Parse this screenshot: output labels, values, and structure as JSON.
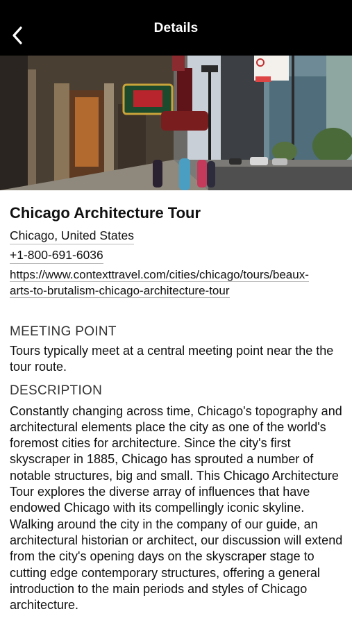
{
  "navbar": {
    "title": "Details",
    "back_icon": "chevron-left-icon",
    "background": "#000000"
  },
  "hero_image": {
    "description_icon": "street-photo"
  },
  "tour": {
    "title": "Chicago Architecture Tour",
    "location": "Chicago, United States",
    "phone": "+1-800-691-6036",
    "url": "https://www.contexttravel.com/cities/chicago/tours/beaux-arts-to-brutalism-chicago-architecture-tour"
  },
  "meeting_point": {
    "heading": "MEETING POINT",
    "text": "Tours typically meet at a central meeting point near the the tour route."
  },
  "description": {
    "heading": "DESCRIPTION",
    "text": "Constantly changing across time, Chicago's topography and architectural elements place the city as one of the world's foremost cities for architecture. Since the city's first skyscraper in 1885, Chicago has sprouted a number of notable structures, big and small. This Chicago Architecture Tour explores the diverse array of influences that have endowed Chicago with its compellingly iconic skyline. Walking around the city in the company of our guide, an architectural historian or architect, our discussion will extend from the city's opening days on the skyscraper stage to cutting edge contemporary structures, offering a general introduction to the main periods and styles of Chicago architecture."
  }
}
